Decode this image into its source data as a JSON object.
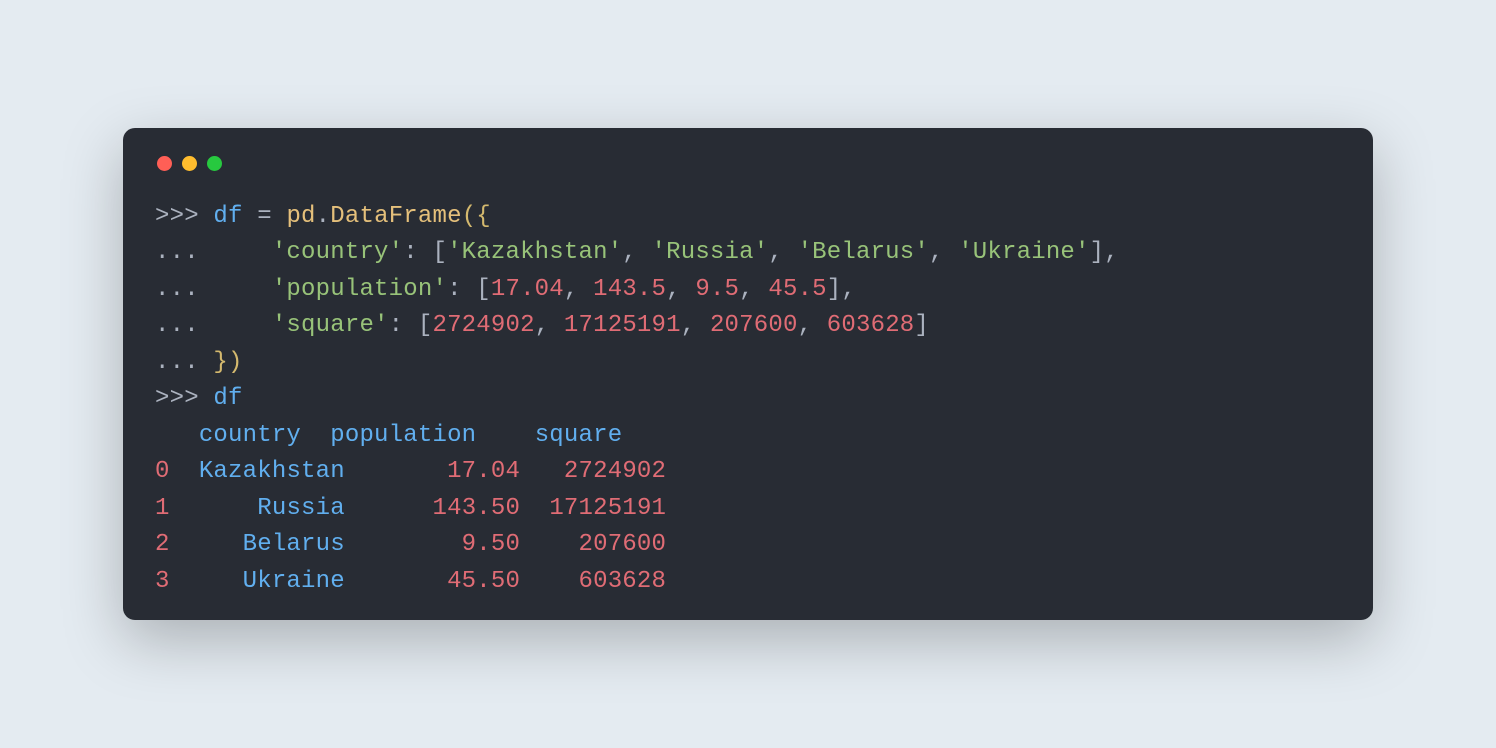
{
  "traffic_colors": {
    "red": "#ff5f56",
    "yellow": "#ffbd2e",
    "green": "#27c93f"
  },
  "c": {
    "l1": {
      "prompt": ">>> ",
      "var": "df",
      "eq": " = ",
      "pd": "pd",
      "dot": ".",
      "fn": "DataFrame",
      "open": "({"
    },
    "l2": {
      "prompt": "...     ",
      "key": "'country'",
      "colon": ": [",
      "v1": "'Kazakhstan'",
      "c1": ", ",
      "v2": "'Russia'",
      "c2": ", ",
      "v3": "'Belarus'",
      "c3": ", ",
      "v4": "'Ukraine'",
      "close": "],"
    },
    "l3": {
      "prompt": "...     ",
      "key": "'population'",
      "colon": ": [",
      "v1": "17.04",
      "c1": ", ",
      "v2": "143.5",
      "c2": ", ",
      "v3": "9.5",
      "c3": ", ",
      "v4": "45.5",
      "close": "],"
    },
    "l4": {
      "prompt": "...     ",
      "key": "'square'",
      "colon": ": [",
      "v1": "2724902",
      "c1": ", ",
      "v2": "17125191",
      "c2": ", ",
      "v3": "207600",
      "c3": ", ",
      "v4": "603628",
      "close": "]"
    },
    "l5": {
      "prompt": "... ",
      "close": "})"
    },
    "l6": {
      "prompt": ">>> ",
      "var": "df"
    },
    "hdr": {
      "pad": "   ",
      "h1": "country",
      "s1": "  ",
      "h2": "population",
      "s2": "    ",
      "h3": "square"
    },
    "r0": {
      "idx": "0",
      "s0": "  ",
      "country": "Kazakhstan",
      "s1": "       ",
      "pop": "17.04",
      "s2": "   ",
      "sq": "2724902"
    },
    "r1": {
      "idx": "1",
      "s0": "      ",
      "country": "Russia",
      "s1": "      ",
      "pop": "143.50",
      "s2": "  ",
      "sq": "17125191"
    },
    "r2": {
      "idx": "2",
      "s0": "     ",
      "country": "Belarus",
      "s1": "        ",
      "pop": "9.50",
      "s2": "    ",
      "sq": "207600"
    },
    "r3": {
      "idx": "3",
      "s0": "     ",
      "country": "Ukraine",
      "s1": "       ",
      "pop": "45.50",
      "s2": "    ",
      "sq": "603628"
    }
  },
  "chart_data": {
    "type": "table",
    "columns": [
      "country",
      "population",
      "square"
    ],
    "index": [
      0,
      1,
      2,
      3
    ],
    "rows": [
      {
        "country": "Kazakhstan",
        "population": 17.04,
        "square": 2724902
      },
      {
        "country": "Russia",
        "population": 143.5,
        "square": 17125191
      },
      {
        "country": "Belarus",
        "population": 9.5,
        "square": 207600
      },
      {
        "country": "Ukraine",
        "population": 45.5,
        "square": 603628
      }
    ]
  }
}
